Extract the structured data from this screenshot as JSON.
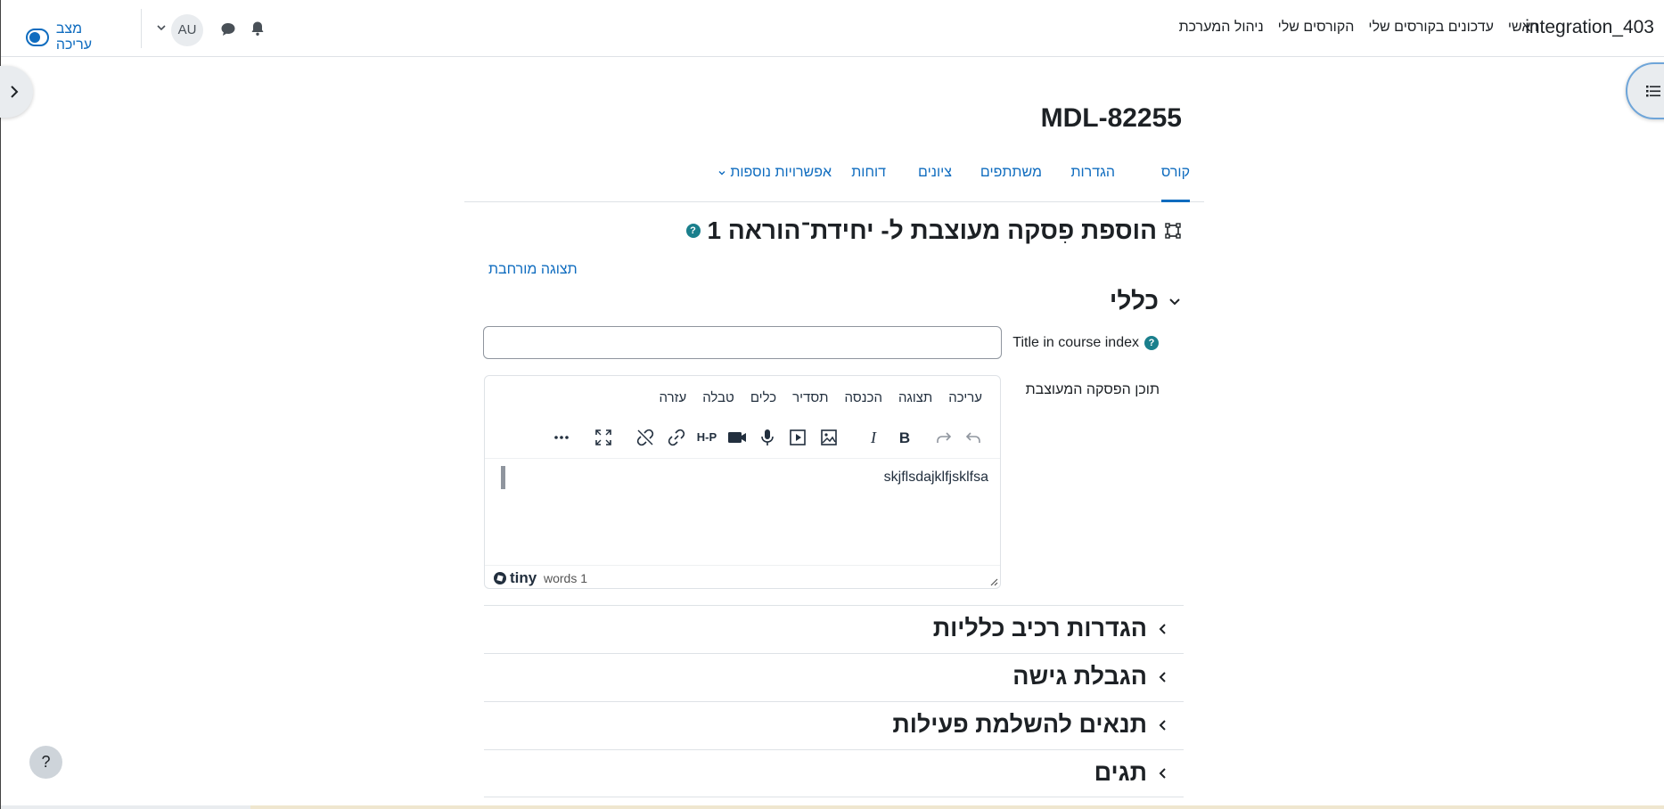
{
  "navbar": {
    "brand": "integration_403",
    "primary_nav": [
      "ראשי",
      "עדכונים בקורסים שלי",
      "הקורסים שלי",
      "ניהול המערכת"
    ],
    "avatar_initials": "AU",
    "edit_mode_label": "מצב עריכה",
    "edit_mode_on": false
  },
  "course": {
    "title": "MDL-82255",
    "tabs": [
      "קורס",
      "הגדרות",
      "משתתפים",
      "ציונים",
      "דוחות",
      "אפשרויות נוספות"
    ],
    "active_tab": "קורס"
  },
  "page": {
    "heading": "הוספת פִסקה מעוצבת ל- יחידת־הוראה 1",
    "expand_all": "תצוגה מורחבת"
  },
  "general_section": {
    "title": "כללי",
    "title_label": "Title in course index",
    "title_value": "",
    "content_label": "תוכן הפסקה המעוצבת"
  },
  "editor": {
    "menu": [
      "עריכה",
      "תצוגה",
      "הכנסה",
      "תסדיר",
      "כלים",
      "טבלה",
      "עזרה"
    ],
    "content": "skjflsdajklfjsklfsa",
    "brand": "tiny",
    "word_count": "words 1",
    "toolbar_h5p_label": "H-P"
  },
  "sections": [
    {
      "title": "הגדרות רכיב כלליות"
    },
    {
      "title": "הגבלת גישה"
    },
    {
      "title": "תנאים להשלמת פעילות"
    },
    {
      "title": "תגים"
    }
  ],
  "help_button": "?",
  "colors": {
    "accent": "#0f6cbf",
    "help_dot": "#1a7f8c",
    "text": "#1d2125"
  }
}
